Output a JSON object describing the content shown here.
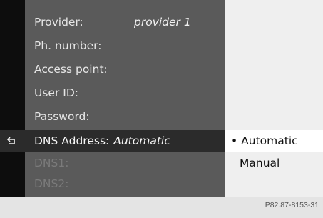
{
  "form": {
    "provider_label": "Provider:",
    "provider_value": "provider 1",
    "phone_label": "Ph. number:",
    "access_point_label": "Access point:",
    "user_id_label": "User ID:",
    "password_label": "Password:",
    "dns_address_label": "DNS Address:",
    "dns_address_value": "Automatic",
    "dns1_label": "DNS1:",
    "dns2_label": "DNS2:"
  },
  "options": {
    "selected_bullet": "•",
    "automatic": "Automatic",
    "manual": "Manual"
  },
  "footer": {
    "image_code": "P82.87-8153-31"
  },
  "icons": {
    "back": "back-arrow-icon"
  }
}
